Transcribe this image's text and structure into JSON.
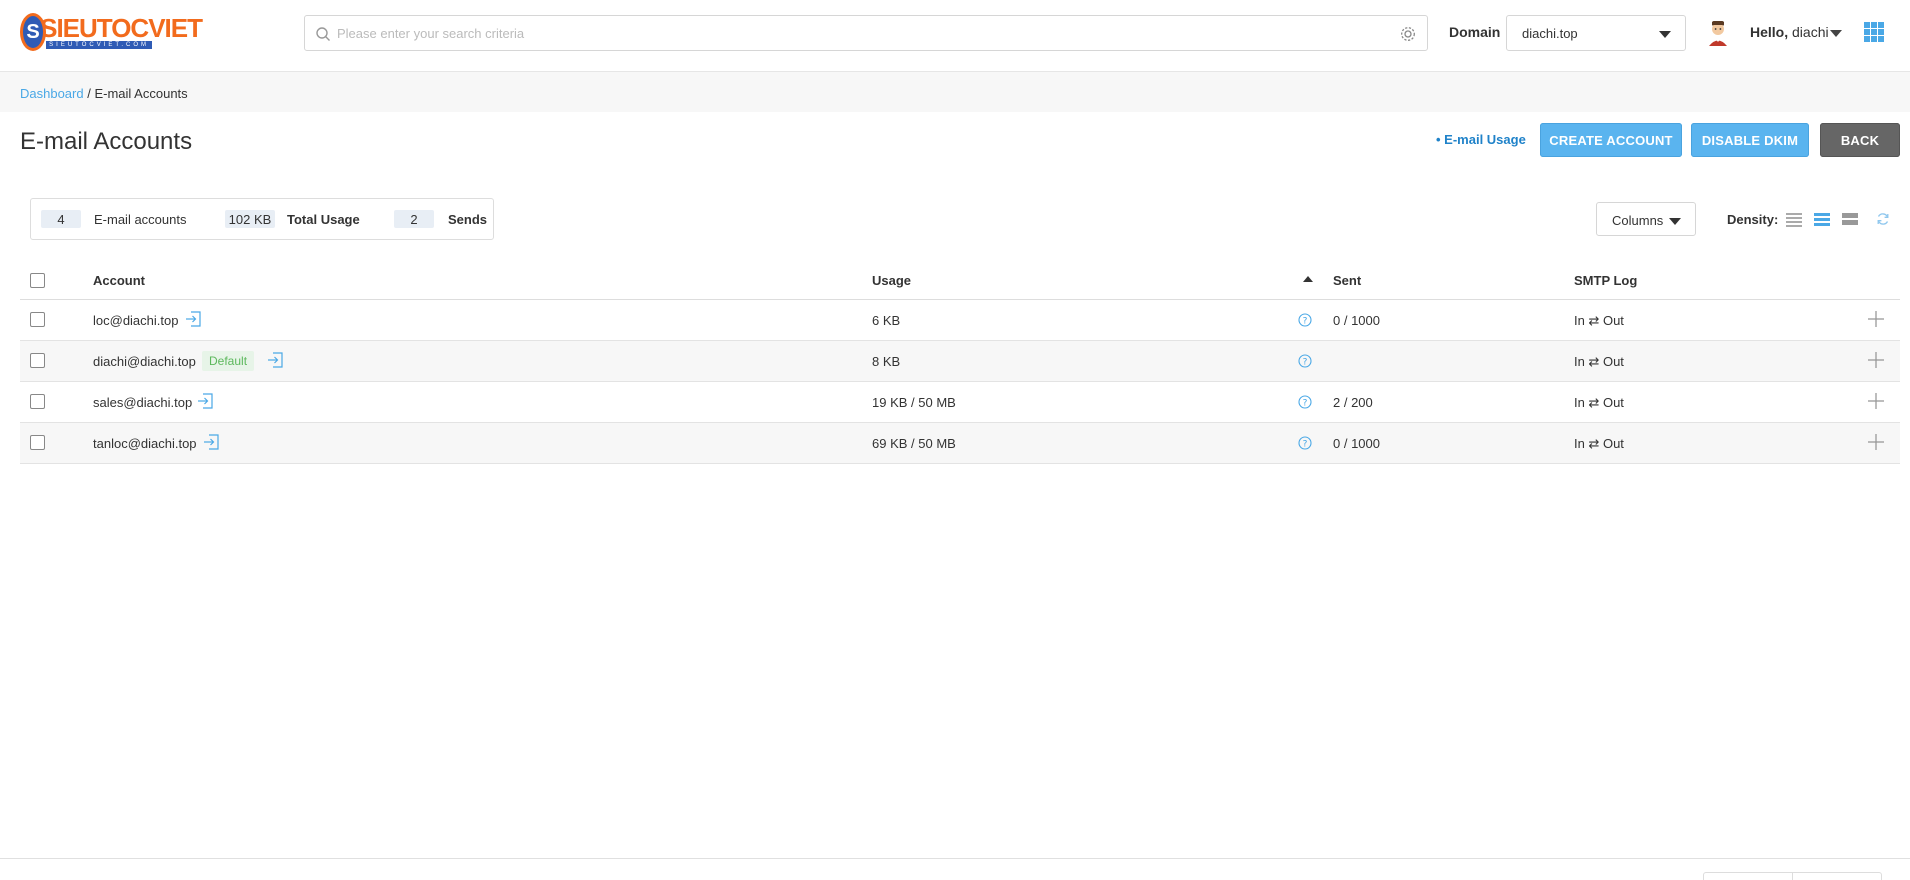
{
  "header": {
    "logo_text": "SIEUTOCVIET",
    "logo_sub": "SIEUTOCVIET.COM",
    "logo_letter": "S",
    "search_placeholder": "Please enter your search criteria",
    "domain_label": "Domain",
    "domain_value": "diachi.top",
    "hello_prefix": "Hello,",
    "username": "diachi"
  },
  "breadcrumb": {
    "root": "Dashboard",
    "separator": " / ",
    "current": "E-mail Accounts"
  },
  "page": {
    "title": "E-mail Accounts",
    "usage_link": "• E-mail Usage",
    "create_label": "CREATE ACCOUNT",
    "dkim_label": "DISABLE DKIM",
    "back_label": "BACK"
  },
  "stats": {
    "accounts_count": "4",
    "accounts_label": "E-mail accounts",
    "usage_value": "102 KB",
    "usage_label": "Total Usage",
    "sends_count": "2",
    "sends_label": "Sends"
  },
  "toolbar": {
    "columns_label": "Columns",
    "density_label": "Density:"
  },
  "table": {
    "headers": {
      "account": "Account",
      "usage": "Usage",
      "sent": "Sent",
      "smtp_log": "SMTP Log"
    },
    "default_badge": "Default",
    "rows": [
      {
        "account": "loc@diachi.top",
        "usage": "6 KB",
        "sent": "0 / 1000",
        "smtp": "In ⇄ Out"
      },
      {
        "account": "diachi@diachi.top",
        "usage": "8 KB",
        "sent": "",
        "smtp": "In ⇄ Out"
      },
      {
        "account": "sales@diachi.top",
        "usage": "19 KB / 50 MB",
        "sent": "2 / 200",
        "smtp": "In ⇄ Out"
      },
      {
        "account": "tanloc@diachi.top",
        "usage": "69 KB / 50 MB",
        "sent": "0 / 1000",
        "smtp": "In ⇄ Out"
      }
    ]
  },
  "colors": {
    "accent": "#5ab4ef",
    "link": "#1f82c9",
    "back_button": "#666666",
    "logo_orange": "#f26b1d",
    "logo_blue": "#2f5bb5",
    "default_badge_bg": "#e7f4e8",
    "default_badge_text": "#5cb85c"
  }
}
